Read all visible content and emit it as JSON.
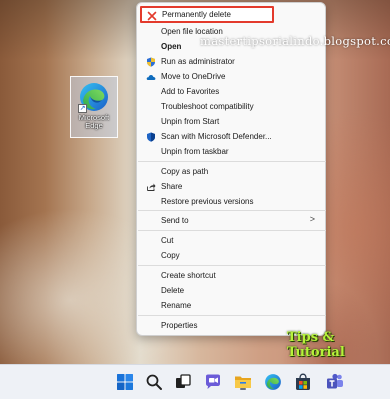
{
  "desktop": {
    "shortcut": {
      "label_line1": "Microsoft",
      "label_line2": "Edge",
      "icon": "edge-icon"
    }
  },
  "context_menu": {
    "items": [
      {
        "label": "Permanently delete",
        "icon": "x-delete-icon",
        "highlighted": true
      },
      {
        "label": "Open file location",
        "icon": ""
      },
      {
        "label": "Open",
        "icon": "",
        "bold": true
      },
      {
        "label": "Run as administrator",
        "icon": "uac-shield-icon"
      },
      {
        "label": "Move to OneDrive",
        "icon": "onedrive-cloud-icon"
      },
      {
        "label": "Add to Favorites",
        "icon": ""
      },
      {
        "label": "Troubleshoot compatibility",
        "icon": ""
      },
      {
        "label": "Unpin from Start",
        "icon": ""
      },
      {
        "label": "Scan with Microsoft Defender...",
        "icon": "defender-shield-icon"
      },
      {
        "label": "Unpin from taskbar",
        "icon": ""
      },
      {
        "label": "Copy as path",
        "icon": ""
      },
      {
        "label": "Share",
        "icon": "share-icon"
      },
      {
        "label": "Restore previous versions",
        "icon": ""
      },
      {
        "label": "Send to",
        "icon": "",
        "submenu": ">"
      },
      {
        "label": "Cut",
        "icon": ""
      },
      {
        "label": "Copy",
        "icon": ""
      },
      {
        "label": "Create shortcut",
        "icon": ""
      },
      {
        "label": "Delete",
        "icon": ""
      },
      {
        "label": "Rename",
        "icon": ""
      },
      {
        "label": "Properties",
        "icon": ""
      }
    ]
  },
  "overlay": {
    "watermark": "mastertipsorialindo.blogspot.com",
    "tips_logo": "Tips & Tutorial"
  },
  "taskbar": {
    "icons": [
      "windows-start-icon",
      "search-icon",
      "task-view-icon",
      "chat-icon",
      "file-explorer-icon",
      "edge-icon",
      "store-icon",
      "teams-icon"
    ]
  },
  "colors": {
    "highlight_border": "#e33a2c",
    "menu_background": "#f9f9f9",
    "accent_blue": "#0f6cbd"
  }
}
